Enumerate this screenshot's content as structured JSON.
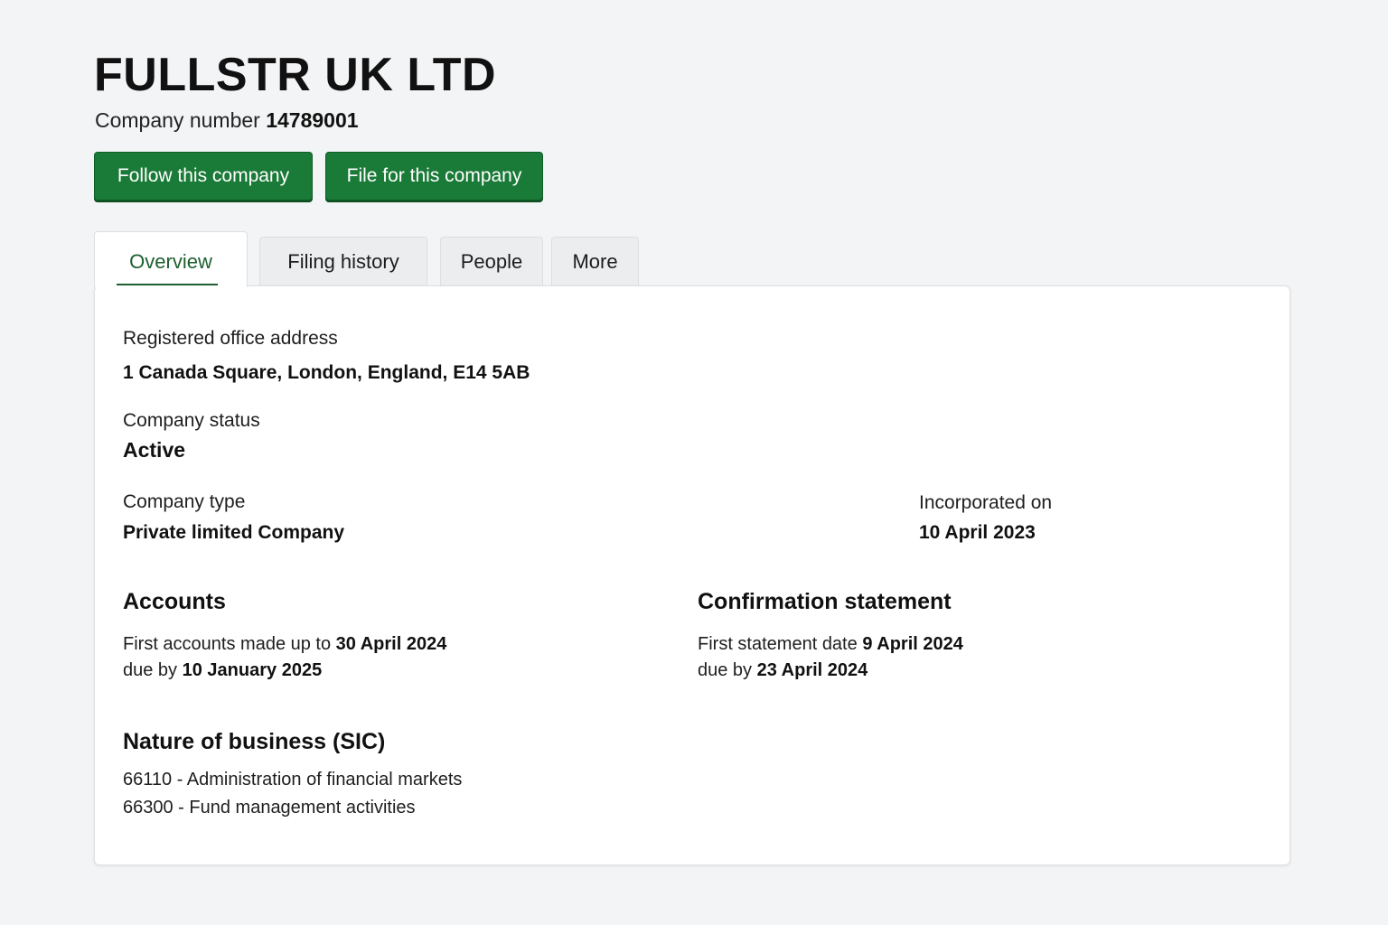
{
  "company": {
    "name": "FULLSTR UK LTD",
    "number_label": "Company number",
    "number": "14789001"
  },
  "actions": {
    "follow_label": "Follow this company",
    "file_label": "File for this company"
  },
  "tabs": [
    {
      "label": "Overview",
      "active": true
    },
    {
      "label": "Filing history",
      "active": false
    },
    {
      "label": "People",
      "active": false
    },
    {
      "label": "More",
      "active": false
    }
  ],
  "overview": {
    "address_label": "Registered office address",
    "address": "1 Canada Square, London, England, E14 5AB",
    "status_label": "Company status",
    "status": "Active",
    "type_label": "Company type",
    "type": "Private limited Company",
    "incorporated_label": "Incorporated on",
    "incorporated": "10 April 2023",
    "accounts": {
      "heading": "Accounts",
      "first_text": "First accounts made up to",
      "first_date": "30 April 2024",
      "due_text": "due by",
      "due_date": "10 January 2025"
    },
    "confirmation": {
      "heading": "Confirmation statement",
      "first_text": "First statement date",
      "first_date": "9 April 2024",
      "due_text": "due by",
      "due_date": "23 April 2024"
    },
    "sic": {
      "heading": "Nature of business (SIC)",
      "items": [
        "66110 - Administration of financial markets",
        "66300 - Fund management activities"
      ]
    }
  },
  "colors": {
    "button_green": "#1a7a37",
    "tab_active_text": "#1d5f2f",
    "background": "#f3f4f5"
  }
}
